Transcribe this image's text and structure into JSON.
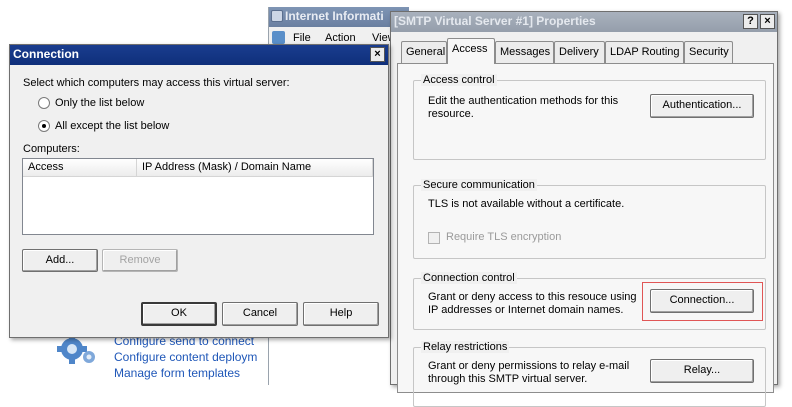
{
  "iis_window": {
    "title": "Internet Informati",
    "menu": [
      "File",
      "Action",
      "View"
    ],
    "links": [
      "Configure send to connect",
      "Configure content deploym",
      "Manage form templates"
    ]
  },
  "connection_dialog": {
    "title": "Connection",
    "close_glyph": "×",
    "prompt": "Select which computers may access this virtual server:",
    "radio_only": "Only the list below",
    "radio_except": "All except the list below",
    "selected_option": "All except the list below",
    "computers_label": "Computers:",
    "columns": [
      "Access",
      "IP Address (Mask) / Domain Name"
    ],
    "rows": [],
    "add_button": "Add...",
    "remove_button": "Remove",
    "ok_button": "OK",
    "cancel_button": "Cancel",
    "help_button": "Help"
  },
  "properties_dialog": {
    "title": "[SMTP Virtual Server #1] Properties",
    "help_glyph": "?",
    "close_glyph": "×",
    "tabs": [
      "General",
      "Access",
      "Messages",
      "Delivery",
      "LDAP Routing",
      "Security"
    ],
    "selected_tab": "Access",
    "access_control": {
      "title": "Access control",
      "text": "Edit the authentication methods for this resource.",
      "button": "Authentication..."
    },
    "secure_communication": {
      "title": "Secure communication",
      "text": "TLS is not available without a certificate.",
      "checkbox_label": "Require TLS encryption",
      "checked": false
    },
    "connection_control": {
      "title": "Connection control",
      "text": "Grant or deny access to this resouce using IP addresses or Internet domain names.",
      "button": "Connection..."
    },
    "relay_restrictions": {
      "title": "Relay restrictions",
      "text": "Grant or deny permissions to relay e-mail through this SMTP virtual server.",
      "button": "Relay..."
    }
  },
  "colors": {
    "active_title": "#0f2f7a",
    "inactive_title": "#959eab",
    "highlight": "#e05555",
    "link": "#1f57b8"
  }
}
